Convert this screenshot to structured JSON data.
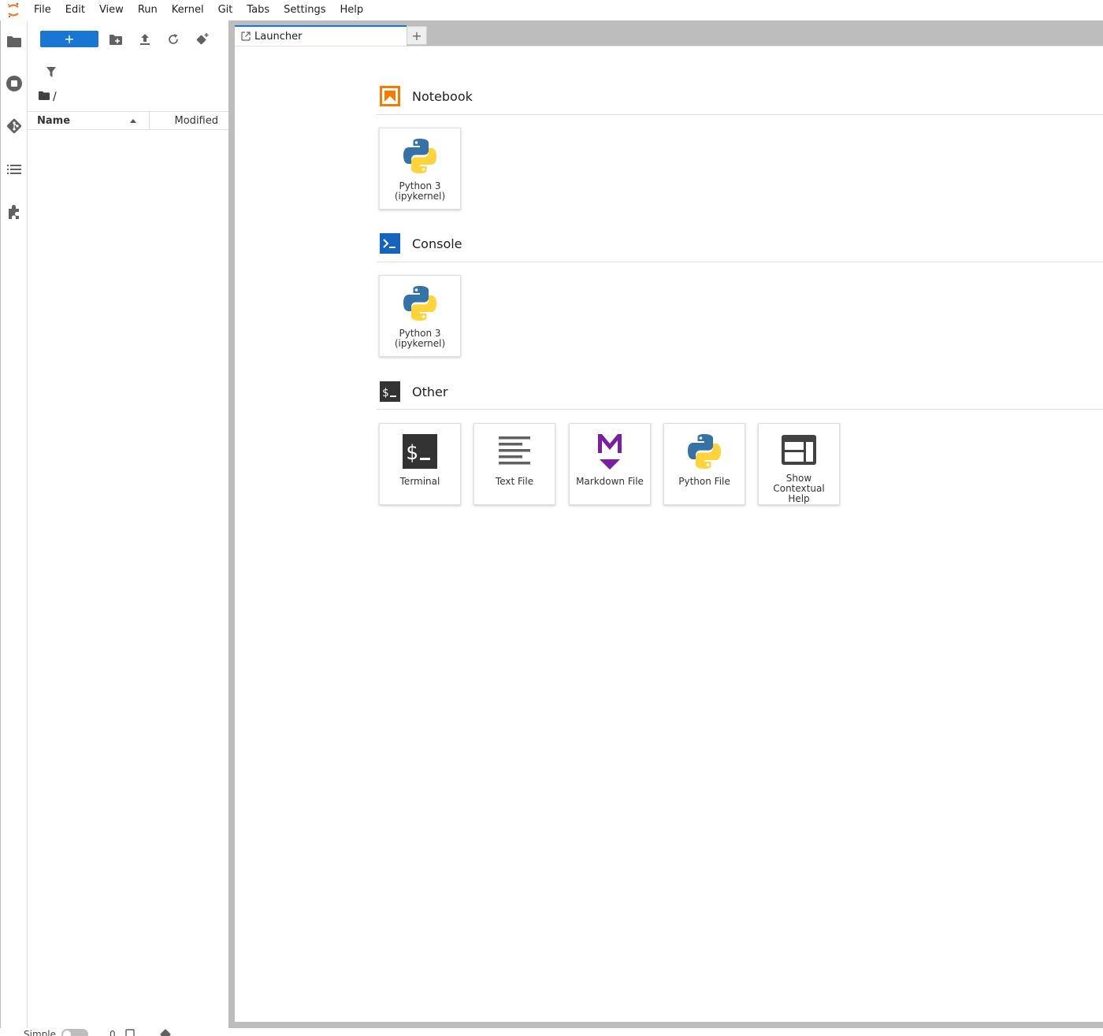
{
  "menubar": {
    "items": [
      "File",
      "Edit",
      "View",
      "Run",
      "Kernel",
      "Git",
      "Tabs",
      "Settings",
      "Help"
    ]
  },
  "activitybar": {
    "icons": [
      "folder-icon",
      "running-icon",
      "git-icon",
      "toc-icon",
      "extension-icon"
    ]
  },
  "filebrowser": {
    "new_button_label": "+",
    "breadcrumb_sep": "/",
    "columns": {
      "name": "Name",
      "modified": "Modified"
    }
  },
  "tabs": {
    "active_label": "Launcher",
    "add_label": "+"
  },
  "launcher": {
    "sections": [
      {
        "title": "Notebook",
        "cards": [
          {
            "label": "Python 3 (ipykernel)"
          }
        ]
      },
      {
        "title": "Console",
        "cards": [
          {
            "label": "Python 3 (ipykernel)"
          }
        ]
      },
      {
        "title": "Other",
        "cards": [
          {
            "label": "Terminal"
          },
          {
            "label": "Text File"
          },
          {
            "label": "Markdown File"
          },
          {
            "label": "Python File"
          },
          {
            "label": "Show Contextual Help"
          }
        ]
      }
    ]
  },
  "statusbar": {
    "mode_label": "Simple",
    "kernel_count": "0"
  },
  "colors": {
    "accent": "#1976d2",
    "notebook": "#f57c00",
    "console": "#1565c0",
    "markdown": "#7b1fa2",
    "python_blue": "#3572a5",
    "python_yellow": "#ffd43b"
  }
}
